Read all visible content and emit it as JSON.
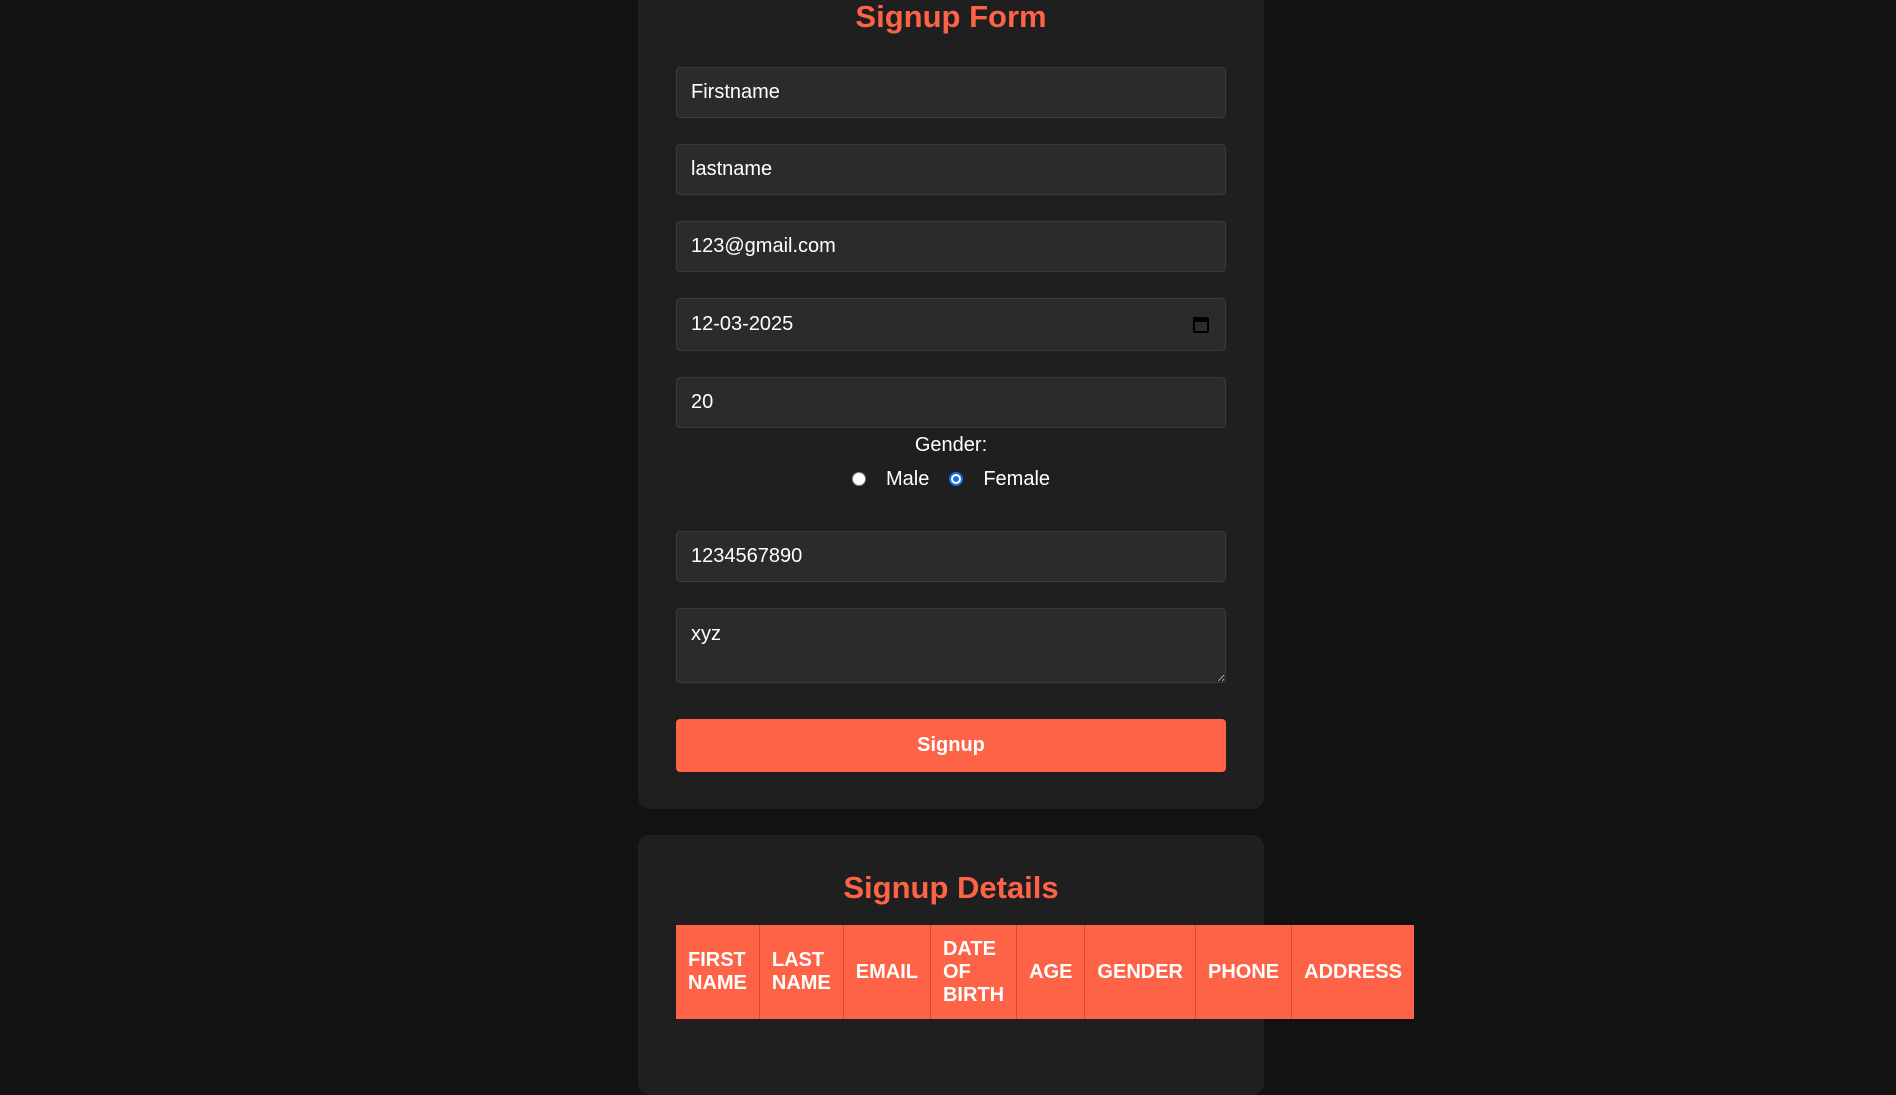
{
  "form": {
    "title": "Signup Form",
    "firstname": "Firstname",
    "lastname": "lastname",
    "email": "123@gmail.com",
    "dob": "12-03-2025",
    "age": "20",
    "gender_label": "Gender:",
    "gender_options": [
      {
        "label": "Male",
        "checked": false
      },
      {
        "label": "Female",
        "checked": true
      }
    ],
    "phone": "1234567890",
    "address": "xyz",
    "submit_label": "Signup"
  },
  "details": {
    "title": "Signup Details",
    "columns": [
      "FIRST NAME",
      "LAST NAME",
      "EMAIL",
      "DATE OF BIRTH",
      "AGE",
      "GENDER",
      "PHONE",
      "ADDRESS"
    ]
  },
  "colors": {
    "accent": "#ff6347",
    "background": "#121212",
    "card": "#1f1f1f",
    "input": "#2b2b2b"
  }
}
